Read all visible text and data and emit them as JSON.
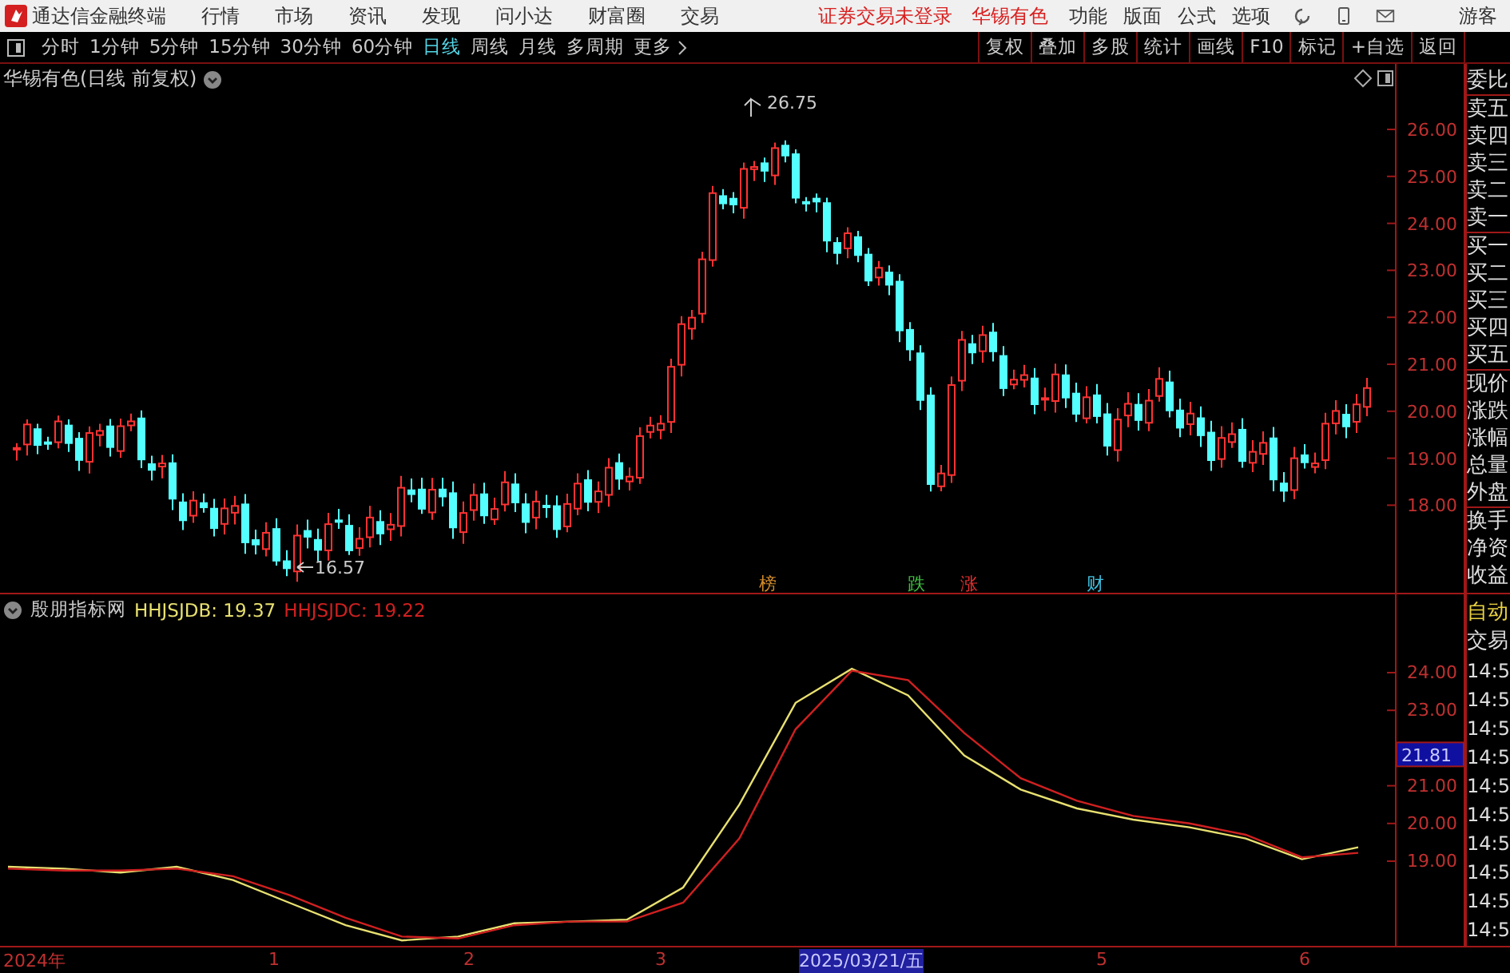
{
  "app": {
    "title": "通达信金融终端"
  },
  "menu": [
    "行情",
    "市场",
    "资讯",
    "发现",
    "问小达",
    "财富圈",
    "交易"
  ],
  "login_status": "证券交易未登录",
  "stock_name": "华锡有色",
  "right_menu": [
    "功能",
    "版面",
    "公式",
    "选项"
  ],
  "user": "游客",
  "periods": [
    {
      "label": "分时",
      "selected": false
    },
    {
      "label": "1分钟",
      "selected": false
    },
    {
      "label": "5分钟",
      "selected": false
    },
    {
      "label": "15分钟",
      "selected": false
    },
    {
      "label": "30分钟",
      "selected": false
    },
    {
      "label": "60分钟",
      "selected": false
    },
    {
      "label": "日线",
      "selected": true
    },
    {
      "label": "周线",
      "selected": false
    },
    {
      "label": "月线",
      "selected": false
    },
    {
      "label": "多周期",
      "selected": false
    }
  ],
  "more": "更多",
  "tools": [
    "复权",
    "叠加",
    "多股",
    "统计",
    "画线",
    "F10",
    "标记",
    "+自选",
    "返回"
  ],
  "price_chart": {
    "title": "华锡有色(日线 前复权)",
    "high_label": "26.75",
    "low_label": "16.57",
    "yticks": [
      "26.00",
      "25.00",
      "24.00",
      "23.00",
      "22.00",
      "21.00",
      "20.00",
      "19.00",
      "18.00"
    ],
    "events": [
      {
        "label": "榜",
        "color": "#d08a2a"
      },
      {
        "label": "跌",
        "color": "#40c040"
      },
      {
        "label": "涨",
        "color": "#e03030"
      },
      {
        "label": "财",
        "color": "#40c0e0"
      }
    ]
  },
  "indicator": {
    "name": "殷朋指标网",
    "legend": [
      {
        "text": "HHJSJDB: 19.37",
        "color": "#e8e070"
      },
      {
        "text": "HHJSJDC: 19.22",
        "color": "#d02020"
      }
    ],
    "yticks": [
      "24.00",
      "23.00",
      "21.00",
      "20.00",
      "19.00"
    ],
    "marker": "21.81"
  },
  "quote_panel": [
    [
      "委比"
    ],
    [
      "卖五",
      "卖四",
      "卖三",
      "卖二",
      "卖一"
    ],
    [
      "买一",
      "买二",
      "买三",
      "买四",
      "买五"
    ],
    [
      "现价",
      "涨跌",
      "涨幅",
      "总量",
      "外盘"
    ],
    [
      "换手",
      "净资",
      "收益"
    ]
  ],
  "trade_panel": {
    "auto": "自动",
    "trade": "交易",
    "times": [
      "14:5",
      "14:5",
      "14:5",
      "14:5",
      "14:5",
      "14:5",
      "14:5",
      "14:5",
      "14:5",
      "14:5"
    ]
  },
  "time_axis": [
    {
      "label": "2024年",
      "selected": false
    },
    {
      "label": "1",
      "selected": false
    },
    {
      "label": "2",
      "selected": false
    },
    {
      "label": "3",
      "selected": false
    },
    {
      "label": "2025/03/21/五",
      "selected": true
    },
    {
      "label": "5",
      "selected": false
    },
    {
      "label": "6",
      "selected": false
    }
  ]
}
